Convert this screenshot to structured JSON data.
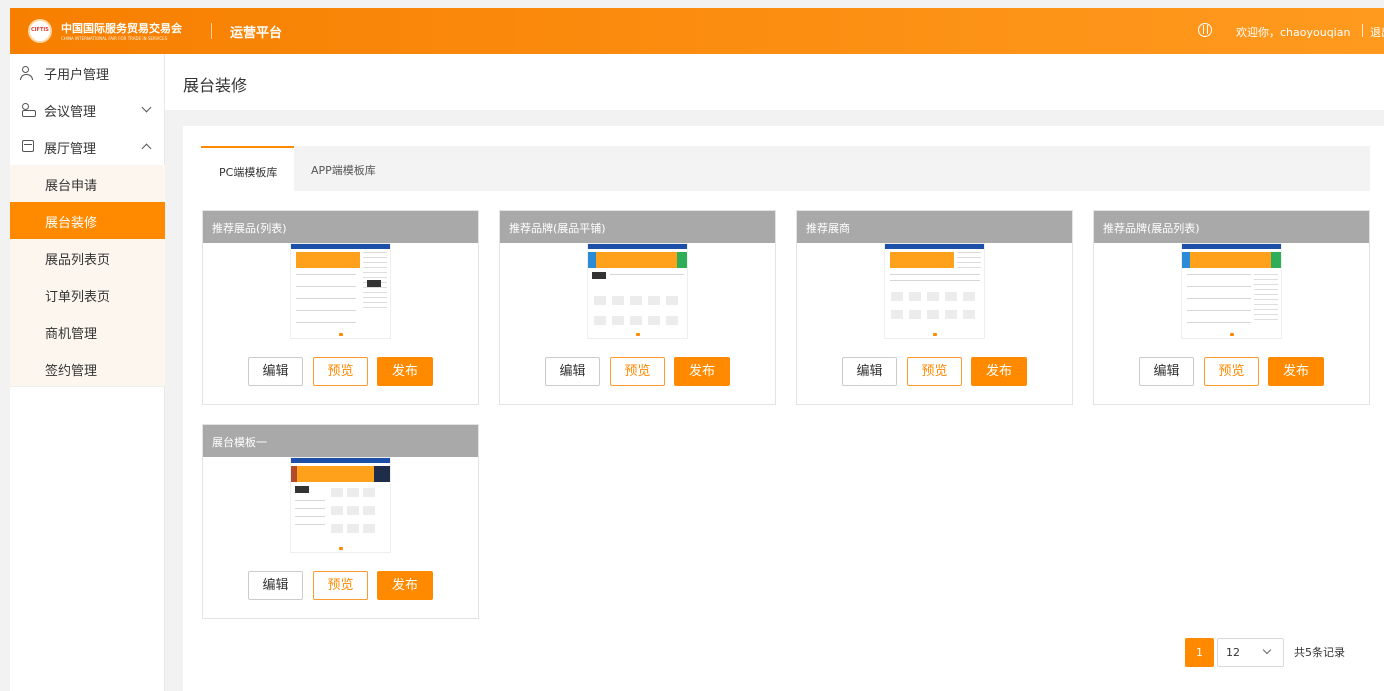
{
  "header": {
    "org_name_cn": "中国国际服务贸易交易会",
    "org_name_en": "CHINA INTERNATIONAL FAIR FOR TRADE IN SERVICES",
    "platform": "运营平台",
    "welcome": "欢迎你，chaoyouqian",
    "logout": "退出"
  },
  "sidebar": {
    "items": [
      {
        "label": "子用户管理"
      },
      {
        "label": "会议管理"
      },
      {
        "label": "展厅管理"
      }
    ],
    "sub_items": [
      {
        "label": "展台申请"
      },
      {
        "label": "展台装修"
      },
      {
        "label": "展品列表页"
      },
      {
        "label": "订单列表页"
      },
      {
        "label": "商机管理"
      },
      {
        "label": "签约管理"
      }
    ]
  },
  "page": {
    "title": "展台装修"
  },
  "tabs": [
    {
      "label": "PC端模板库"
    },
    {
      "label": "APP端模板库"
    }
  ],
  "cards": [
    {
      "title": "推荐展品(列表)"
    },
    {
      "title": "推荐品牌(展品平铺)"
    },
    {
      "title": "推荐展商"
    },
    {
      "title": "推荐品牌(展品列表)"
    },
    {
      "title": "展台模板一"
    }
  ],
  "buttons": {
    "edit": "编辑",
    "preview": "预览",
    "publish": "发布"
  },
  "pagination": {
    "current_page": "1",
    "page_size": "12",
    "total": "共5条记录"
  },
  "colors": {
    "accent": "#ff8a00",
    "card_header": "#a9a9a9"
  }
}
